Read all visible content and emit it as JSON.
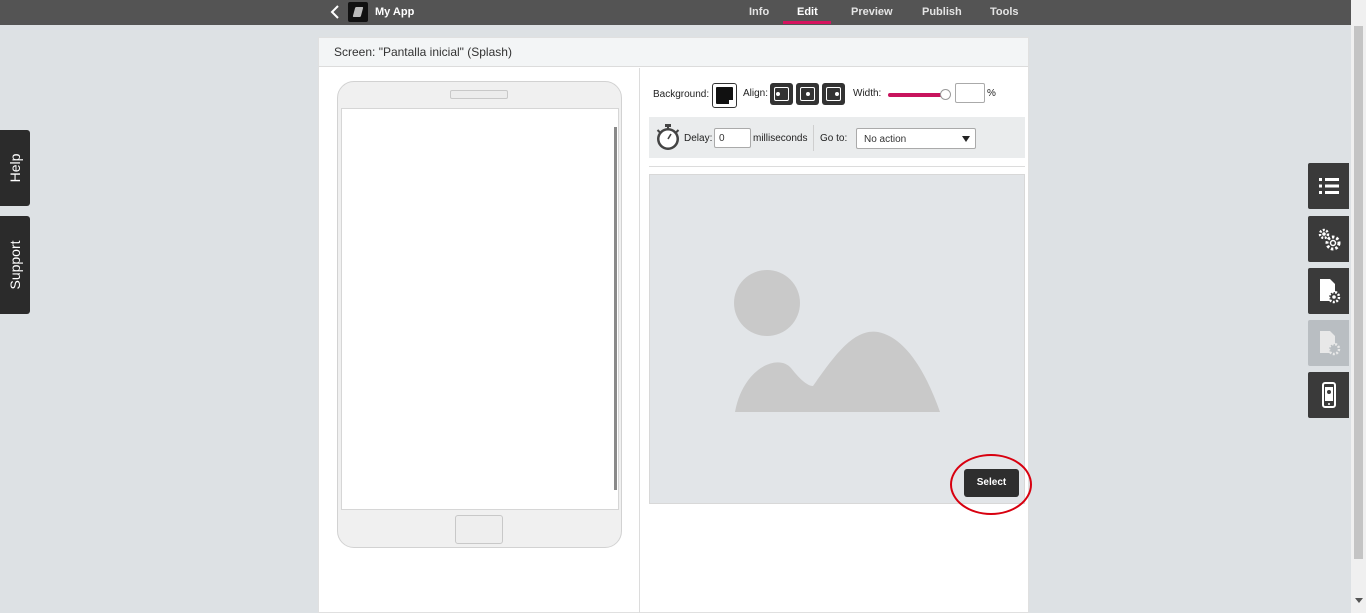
{
  "topbar": {
    "app_name": "My App",
    "tabs": [
      {
        "label": "Info"
      },
      {
        "label": "Edit"
      },
      {
        "label": "Preview"
      },
      {
        "label": "Publish"
      },
      {
        "label": "Tools"
      }
    ],
    "active_tab": "Edit",
    "accent_color": "#d6145f"
  },
  "side_tabs": {
    "help": "Help",
    "support": "Support"
  },
  "right_toolbar": {
    "icons": [
      "list-icon",
      "gears-icon",
      "page-settings-icon",
      "page-settings-disabled-icon",
      "mobile-device-icon"
    ]
  },
  "panel": {
    "title": "Screen: \"Pantalla inicial\" (Splash)",
    "background_label": "Background:",
    "align_label": "Align:",
    "width_label": "Width:",
    "width_value": "",
    "width_unit": "%",
    "width_slider_fraction": 0.95,
    "delay_label": "Delay:",
    "delay_value": "0",
    "delay_unit": "milliseconds",
    "goto_label": "Go to:",
    "goto_value": "No action",
    "select_button": "Select"
  }
}
